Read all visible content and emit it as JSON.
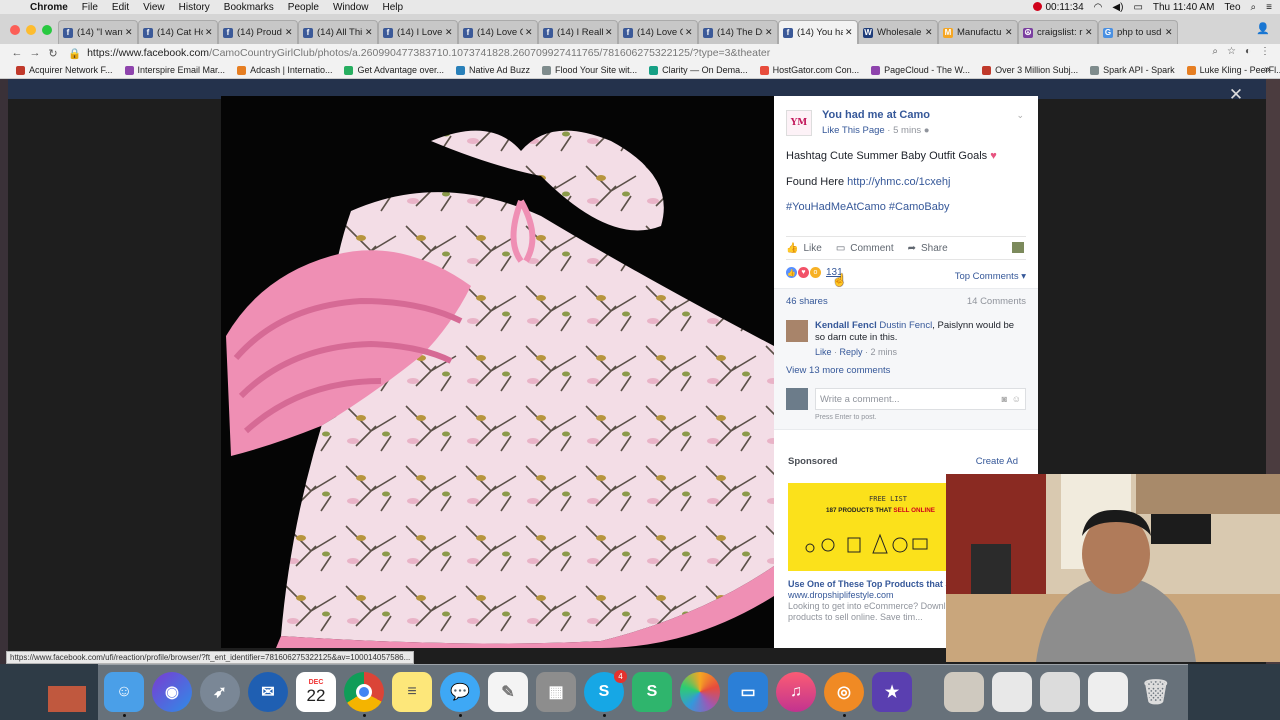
{
  "menubar": {
    "app": "Chrome",
    "items": [
      "File",
      "Edit",
      "View",
      "History",
      "Bookmarks",
      "People",
      "Window",
      "Help"
    ],
    "timer": "00:11:34",
    "clock": "Thu 11:40 AM",
    "user": "Teo"
  },
  "tabs": [
    {
      "label": "(14) \"I want",
      "fav": "f",
      "color": "#3b5998"
    },
    {
      "label": "(14) Cat Ho",
      "fav": "f",
      "color": "#3b5998"
    },
    {
      "label": "(14) Proud",
      "fav": "f",
      "color": "#3b5998"
    },
    {
      "label": "(14) All Thi",
      "fav": "f",
      "color": "#3b5998"
    },
    {
      "label": "(14) I Love",
      "fav": "f",
      "color": "#3b5998"
    },
    {
      "label": "(14) Love C",
      "fav": "f",
      "color": "#3b5998"
    },
    {
      "label": "(14) I Really",
      "fav": "f",
      "color": "#3b5998"
    },
    {
      "label": "(14) Love G",
      "fav": "f",
      "color": "#3b5998"
    },
    {
      "label": "(14) The Dr",
      "fav": "f",
      "color": "#3b5998"
    },
    {
      "label": "(14) You ha",
      "fav": "f",
      "color": "#3b5998",
      "active": true
    },
    {
      "label": "Wholesale",
      "fav": "W",
      "color": "#1f3d7a"
    },
    {
      "label": "Manufactu",
      "fav": "M",
      "color": "#f5a623"
    },
    {
      "label": "craigslist: r",
      "fav": "☮",
      "color": "#7b3fa0"
    },
    {
      "label": "php to usd",
      "fav": "G",
      "color": "#4a90e2"
    }
  ],
  "url": {
    "host": "https://www.facebook.com",
    "path": "/CamoCountryGirlClub/photos/a.260990477383710.1073741828.260709927411765/781606275322125/?type=3&theater"
  },
  "bookmarks": [
    {
      "label": "Acquirer Network F...",
      "color": "#c0392b"
    },
    {
      "label": "Interspire Email Mar...",
      "color": "#8e44ad"
    },
    {
      "label": "Adcash | Internatio...",
      "color": "#e67e22"
    },
    {
      "label": "Get Advantage over...",
      "color": "#27ae60"
    },
    {
      "label": "Native Ad Buzz",
      "color": "#2980b9"
    },
    {
      "label": "Flood Your Site wit...",
      "color": "#7f8c8d"
    },
    {
      "label": "Clarity — On Dema...",
      "color": "#16a085"
    },
    {
      "label": "HostGator.com Con...",
      "color": "#e74c3c"
    },
    {
      "label": "PageCloud - The W...",
      "color": "#8e44ad"
    },
    {
      "label": "Over 3 Million Subj...",
      "color": "#c0392b"
    },
    {
      "label": "Spark API - Spark",
      "color": "#7f8c8d"
    },
    {
      "label": "Luke Kling - PeerFl...",
      "color": "#e67e22"
    }
  ],
  "post": {
    "page_logo": "YM",
    "page_name": "You had me at Camo",
    "like_page": "Like This Page",
    "time": "5 mins",
    "text": "Hashtag Cute Summer Baby Outfit Goals",
    "found_here": "Found Here ",
    "link": "http://yhmc.co/1cxehj",
    "hashtags": "#YouHadMeAtCamo #CamoBaby",
    "actions": {
      "like": "Like",
      "comment": "Comment",
      "share": "Share"
    },
    "reaction_count": "131",
    "top_comments": "Top Comments",
    "shares": "46 shares",
    "comments_count": "14 Comments"
  },
  "comment": {
    "author": "Kendall Fencl",
    "tag": "Dustin Fencl",
    "text": ", Paislynn would be so darn cute in this.",
    "like": "Like",
    "reply": "Reply",
    "time": "2 mins"
  },
  "view_more": "View 13 more comments",
  "comment_input": {
    "placeholder": "Write a comment...",
    "hint": "Press Enter to post."
  },
  "ad": {
    "sponsored": "Sponsored",
    "create_ad": "Create Ad",
    "image_tag": "FREE LIST",
    "image_line_prefix": "187 PRODUCTS THAT ",
    "image_line_red": "SELL ONLINE",
    "title": "Use One of These Top Products that S",
    "url": "www.dropshiplifestyle.com",
    "desc": "Looking to get into eCommerce? Downl products to sell online. Save tim..."
  },
  "status_url": "https://www.facebook.com/ufi/reaction/profile/browser/?ft_ent_identifier=781606275322125&av=100014057586...",
  "dock": {
    "calendar_month": "DEC",
    "calendar_day": "22",
    "skype_badge": "4"
  }
}
